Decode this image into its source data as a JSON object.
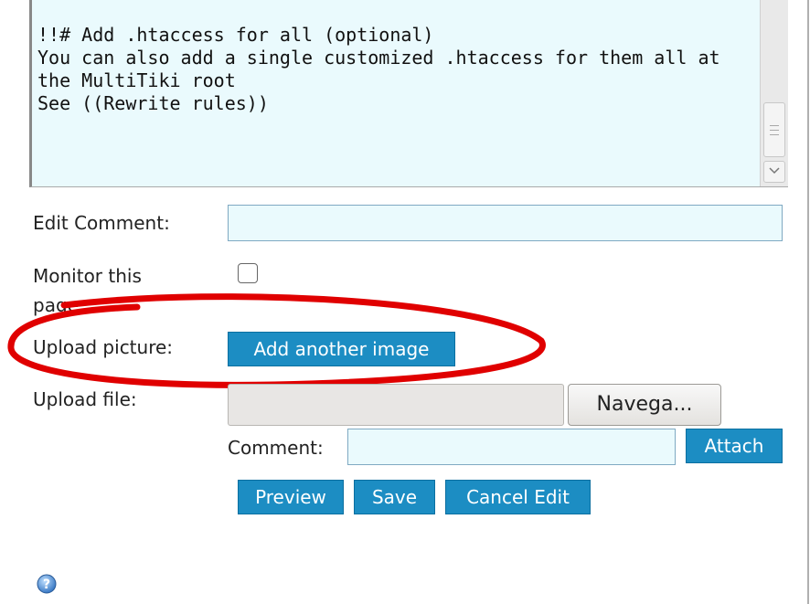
{
  "editor": {
    "content": "!!# Add .htaccess for all (optional)\nYou can also add a single customized .htaccess for them all at the MultiTiki root\nSee ((Rewrite rules))"
  },
  "form": {
    "edit_comment_label": "Edit Comment:",
    "edit_comment_value": "",
    "monitor_label": "Monitor this page:",
    "monitor_checked": false,
    "upload_picture_label": "Upload picture:",
    "add_image_button": "Add another image",
    "upload_file_label": "Upload file:",
    "browse_button": "Navega...",
    "comment_label": "Comment:",
    "comment_value": "",
    "attach_button": "Attach"
  },
  "actions": {
    "preview": "Preview",
    "save": "Save",
    "cancel": "Cancel Edit"
  },
  "colors": {
    "button_blue": "#1c8dc3",
    "input_bg": "#eafafd",
    "highlight_red": "#e00000"
  },
  "icons": {
    "help": "help-icon",
    "checkbox": "checkbox-icon",
    "scroll_down": "chevron-down-icon"
  }
}
